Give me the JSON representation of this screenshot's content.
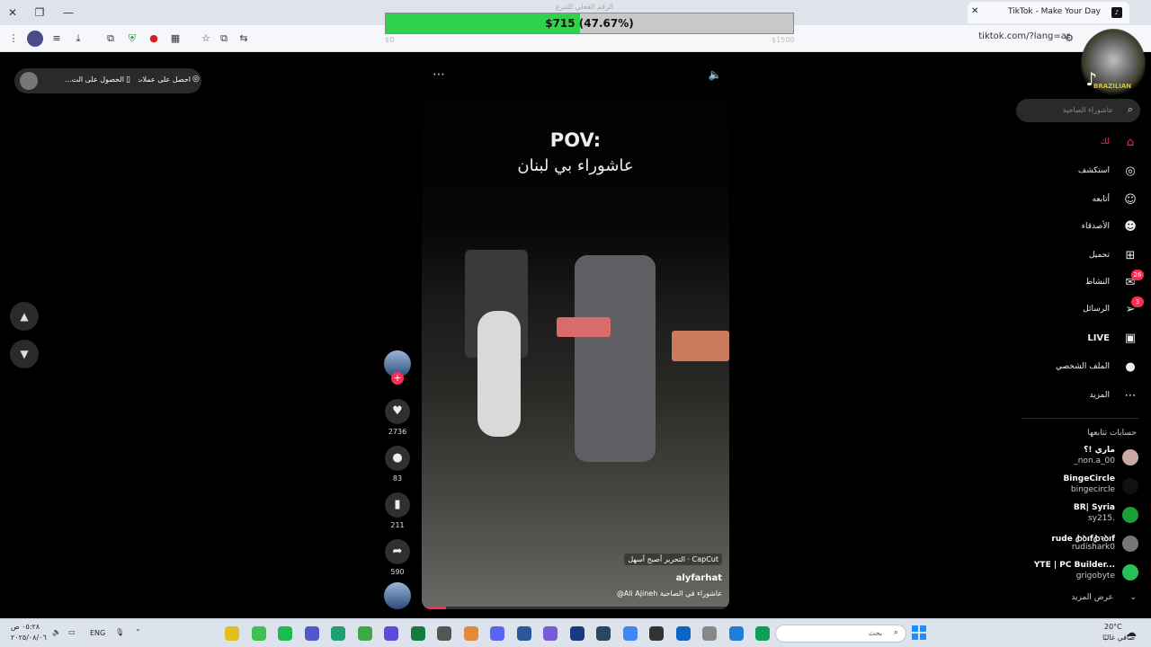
{
  "browser": {
    "tab_title": "TikTok - Make Your Day",
    "tab_favicon": "tiktok-icon",
    "url": "tiktok.com/?lang=ar",
    "window_controls": [
      "close-icon",
      "maximize-icon",
      "minimize-icon"
    ]
  },
  "progress": {
    "label": "$715 (47.67%)",
    "fraction": 0.4767,
    "faint_title": "الرقم الفعلي للتبرع",
    "min_label": "$0",
    "max_label": "$1500",
    "fill_color": "#31d24b"
  },
  "coins_pill": {
    "label_1": "احصل على عملات",
    "label_2": "الحصول على الت..."
  },
  "video": {
    "pov": "POV:",
    "subtitle": "عاشوراء بي لبنان",
    "capcut": "CapCut · التحرير أصبح أسهل",
    "author": "alyfarhat",
    "caption": "عاشوراء في الصاحية Ali Ajineh@"
  },
  "actions": {
    "likes": "2736",
    "comments": "83",
    "saves": "211",
    "shares": "590"
  },
  "sidebar": {
    "logo": "TikTok",
    "search_placeholder": "عاشوراء الصاحية",
    "menu": [
      {
        "label": "لك",
        "icon": "home-icon",
        "active": true
      },
      {
        "label": "استكشف",
        "icon": "compass-icon"
      },
      {
        "label": "أتابعه",
        "icon": "user-follow-icon"
      },
      {
        "label": "الأصدقاء",
        "icon": "friends-icon"
      },
      {
        "label": "تحميل",
        "icon": "upload-icon"
      },
      {
        "label": "النشاط",
        "icon": "activity-icon",
        "badge": "26"
      },
      {
        "label": "الرسائل",
        "icon": "messages-icon",
        "badge": "3"
      },
      {
        "label": "LIVE",
        "icon": "live-icon"
      },
      {
        "label": "الملف الشخصي",
        "icon": "profile-avatar"
      },
      {
        "label": "المزيد",
        "icon": "more-icon"
      }
    ],
    "following_title": "حسابات تتابعها",
    "accounts": [
      {
        "name": "ماري !؟",
        "handle": "_non.a_00",
        "color": "#c9a9a0"
      },
      {
        "name": "BingeCircle",
        "handle": "bingecircle",
        "color": "#111",
        "verified": true
      },
      {
        "name": "BR| Syria",
        "handle": "sy215.",
        "color": "#1b9e3a"
      },
      {
        "name": "rude ꞗꝺıfꞗꝛꝺıf",
        "handle": "rudishark0",
        "color": "#777"
      },
      {
        "name": "YTE | PC Builder...",
        "handle": "grigobyte",
        "color": "#2bbf5a"
      }
    ],
    "show_more": "عرض المزيد"
  },
  "taskbar": {
    "time": "٠٥:٢٨ ص",
    "date": "٢٠٢٥/٠٨/٠٦",
    "lang": "ENG",
    "search_label": "بحث",
    "weather_temp": "20°C",
    "weather_desc": "صافي غالبًا"
  }
}
